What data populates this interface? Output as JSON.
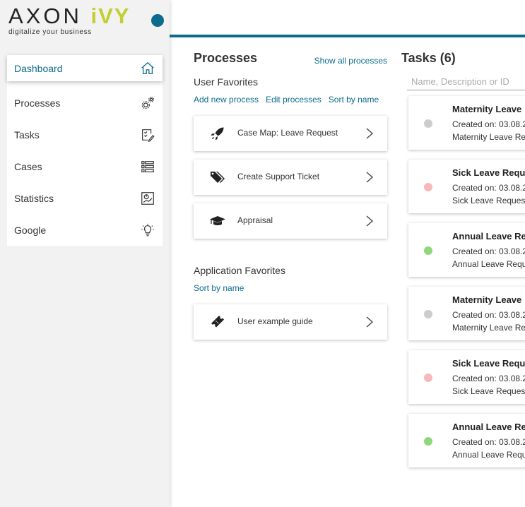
{
  "logo": {
    "brand_a": "AXON",
    "brand_b": "iVY",
    "tagline": "digitalize your business"
  },
  "colors": {
    "accent": "#0d6c8c",
    "brand_green": "#c2cf2f",
    "state_gray": "#cccccc",
    "state_red": "#f7b9b9",
    "state_green": "#8fd77a"
  },
  "sidebar": {
    "items": [
      {
        "label": "Dashboard",
        "icon": "home-icon",
        "active": true
      },
      {
        "label": "Processes",
        "icon": "gears-icon"
      },
      {
        "label": "Tasks",
        "icon": "task-check-icon"
      },
      {
        "label": "Cases",
        "icon": "list-icon"
      },
      {
        "label": "Statistics",
        "icon": "chart-icon"
      },
      {
        "label": "Google",
        "icon": "lightbulb-icon"
      }
    ]
  },
  "processes": {
    "title": "Processes",
    "show_all": "Show all processes",
    "user_favorites": {
      "label": "User Favorites",
      "links": {
        "add": "Add new process",
        "edit": "Edit processes",
        "sort": "Sort by name"
      },
      "items": [
        {
          "label": "Case Map: Leave Request",
          "icon": "rocket-icon"
        },
        {
          "label": "Create Support Ticket",
          "icon": "tags-icon"
        },
        {
          "label": "Appraisal",
          "icon": "graduation-cap-icon"
        }
      ]
    },
    "app_favorites": {
      "label": "Application Favorites",
      "sort": "Sort by name",
      "items": [
        {
          "label": "User example guide",
          "icon": "ticket-icon"
        }
      ]
    }
  },
  "tasks": {
    "title": "Tasks (6)",
    "search_placeholder": "Name, Description or ID",
    "items": [
      {
        "name": "Maternity Leave",
        "created": "Created on: 03.08.2",
        "desc": "Maternity Leave Re",
        "state": "#cccccc"
      },
      {
        "name": "Sick Leave Requ",
        "created": "Created on: 03.08.2",
        "desc": "Sick Leave Request",
        "state": "#f7b9b9"
      },
      {
        "name": "Annual Leave Re",
        "created": "Created on: 03.08.2",
        "desc": "Annual Leave Requ",
        "state": "#8fd77a"
      },
      {
        "name": "Maternity Leave",
        "created": "Created on: 03.08.2",
        "desc": "Maternity Leave Re",
        "state": "#cccccc"
      },
      {
        "name": "Sick Leave Requ",
        "created": "Created on: 03.08.2",
        "desc": "Sick Leave Request",
        "state": "#f7b9b9"
      },
      {
        "name": "Annual Leave Re",
        "created": "Created on: 03.08.2",
        "desc": "Annual Leave Requ",
        "state": "#8fd77a"
      }
    ]
  }
}
